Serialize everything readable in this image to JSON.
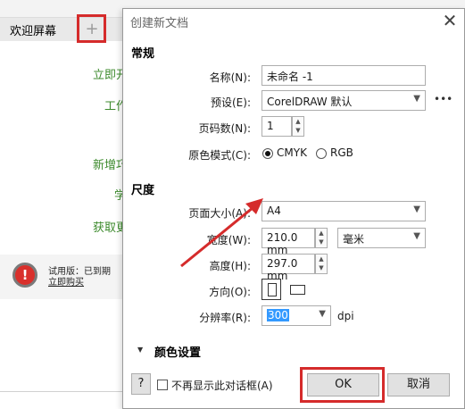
{
  "background_app": {
    "welcome_tab": "欢迎屏幕",
    "plus_label": "+",
    "links": [
      "立即开",
      "工作",
      "新增巧",
      "学",
      "获取更"
    ],
    "trial_status": "试用版：已到期",
    "trial_buy": "立即购买",
    "trial_icon_glyph": "!"
  },
  "dialog": {
    "title": "创建新文档",
    "close_glyph": "✕",
    "general": {
      "heading": "常规",
      "name_label": "名称(N):",
      "name_value": "未命名 -1",
      "preset_label": "预设(E):",
      "preset_value": "CorelDRAW 默认",
      "more_glyph": "•••",
      "pages_label": "页码数(N):",
      "pages_value": "1",
      "color_mode_label": "原色模式(C):",
      "color_mode_options": [
        "CMYK",
        "RGB"
      ],
      "color_mode_selected": "CMYK"
    },
    "size": {
      "heading": "尺度",
      "page_size_label": "页面大小(A):",
      "page_size_value": "A4",
      "width_label": "宽度(W):",
      "width_value": "210.0 mm",
      "unit_value": "毫米",
      "height_label": "高度(H):",
      "height_value": "297.0 mm",
      "orientation_label": "方向(O):",
      "resolution_label": "分辨率(R):",
      "resolution_value": "300",
      "resolution_unit": "dpi"
    },
    "color_settings": {
      "label": "颜色设置",
      "toggle_glyph": "▼"
    },
    "footer": {
      "help_label": "?",
      "dont_show_label": "不再显示此对话框(A)",
      "ok_label": "OK",
      "cancel_label": "取消"
    }
  },
  "colors": {
    "highlight_red": "#d52b2b",
    "link_green": "#3c8a2c",
    "selection_blue": "#3399ff"
  }
}
